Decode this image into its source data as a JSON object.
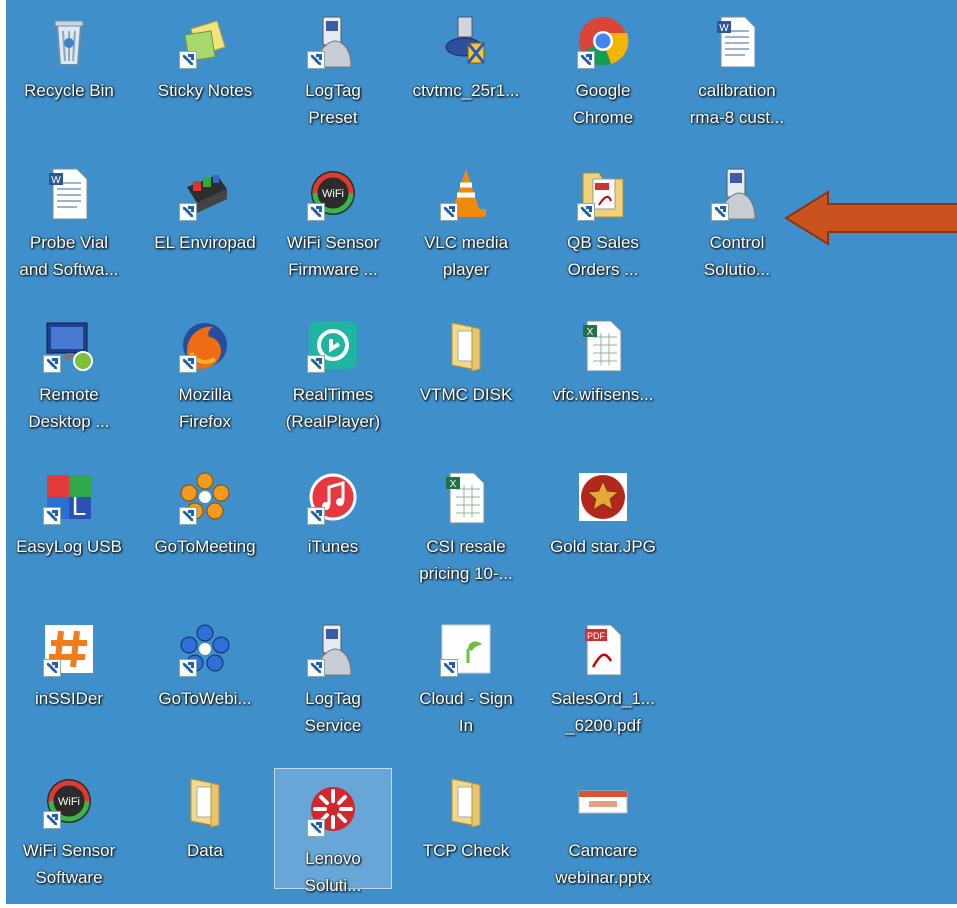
{
  "desktop": {
    "icons": [
      {
        "line1": "Recycle Bin",
        "line2": "",
        "icon": "recycle-bin-icon"
      },
      {
        "line1": "Sticky Notes",
        "line2": "",
        "icon": "sticky-notes-icon"
      },
      {
        "line1": "LogTag",
        "line2": "Preset",
        "icon": "logtag-icon"
      },
      {
        "line1": "ctvtmc_25r1...",
        "line2": "",
        "icon": "installer-icon"
      },
      {
        "line1": "Google",
        "line2": "Chrome",
        "icon": "chrome-icon"
      },
      {
        "line1": "calibration",
        "line2": "rma-8 cust...",
        "icon": "word-document-icon"
      },
      {
        "line1": "Probe Vial",
        "line2": "and Softwa...",
        "icon": "word-document-icon"
      },
      {
        "line1": "EL Enviropad",
        "line2": "",
        "icon": "enviropad-icon"
      },
      {
        "line1": "WiFi Sensor",
        "line2": "Firmware ...",
        "icon": "wifi-sensor-icon"
      },
      {
        "line1": "VLC media",
        "line2": "player",
        "icon": "vlc-icon"
      },
      {
        "line1": "QB Sales",
        "line2": "Orders ...",
        "icon": "pdf-folder-icon"
      },
      {
        "line1": "Control",
        "line2": "Solutio...",
        "icon": "logtag-icon"
      },
      {
        "line1": "Remote",
        "line2": "Desktop ...",
        "icon": "remote-desktop-icon"
      },
      {
        "line1": "Mozilla",
        "line2": "Firefox",
        "icon": "firefox-icon"
      },
      {
        "line1": "RealTimes",
        "line2": "(RealPlayer)",
        "icon": "realtimes-icon"
      },
      {
        "line1": "VTMC DISK",
        "line2": "",
        "icon": "folder-icon"
      },
      {
        "line1": "vfc.wifisens...",
        "line2": "",
        "icon": "excel-document-icon"
      },
      {
        "line1": "EasyLog USB",
        "line2": "",
        "icon": "easylog-icon"
      },
      {
        "line1": "GoToMeeting",
        "line2": "",
        "icon": "gotomeeting-icon"
      },
      {
        "line1": "iTunes",
        "line2": "",
        "icon": "itunes-icon"
      },
      {
        "line1": "CSI resale",
        "line2": "pricing 10-...",
        "icon": "excel-document-icon"
      },
      {
        "line1": "Gold star.JPG",
        "line2": "",
        "icon": "image-icon"
      },
      {
        "line1": "inSSIDer",
        "line2": "",
        "icon": "inssider-icon"
      },
      {
        "line1": "GoToWebi...",
        "line2": "",
        "icon": "gotowebinar-icon"
      },
      {
        "line1": "LogTag",
        "line2": "Service",
        "icon": "logtag-icon"
      },
      {
        "line1": "Cloud - Sign",
        "line2": "In",
        "icon": "web-shortcut-icon"
      },
      {
        "line1": "SalesOrd_1...",
        "line2": "_6200.pdf",
        "icon": "pdf-icon"
      },
      {
        "line1": "WiFi Sensor",
        "line2": "Software",
        "icon": "wifi-sensor-icon"
      },
      {
        "line1": "Data",
        "line2": "",
        "icon": "folder-icon"
      },
      {
        "line1": "Lenovo",
        "line2": "Soluti...",
        "icon": "lenovo-solutions-icon"
      },
      {
        "line1": "TCP Check",
        "line2": "",
        "icon": "folder-icon"
      },
      {
        "line1": "Camcare",
        "line2": "webinar.pptx",
        "icon": "powerpoint-icon"
      }
    ]
  },
  "annotation": {
    "arrow_color": "#c9521e",
    "points_to": "Control Solutio..."
  },
  "colors": {
    "desktop_bg": "#3f8fca",
    "label_text": "#ffffff"
  }
}
